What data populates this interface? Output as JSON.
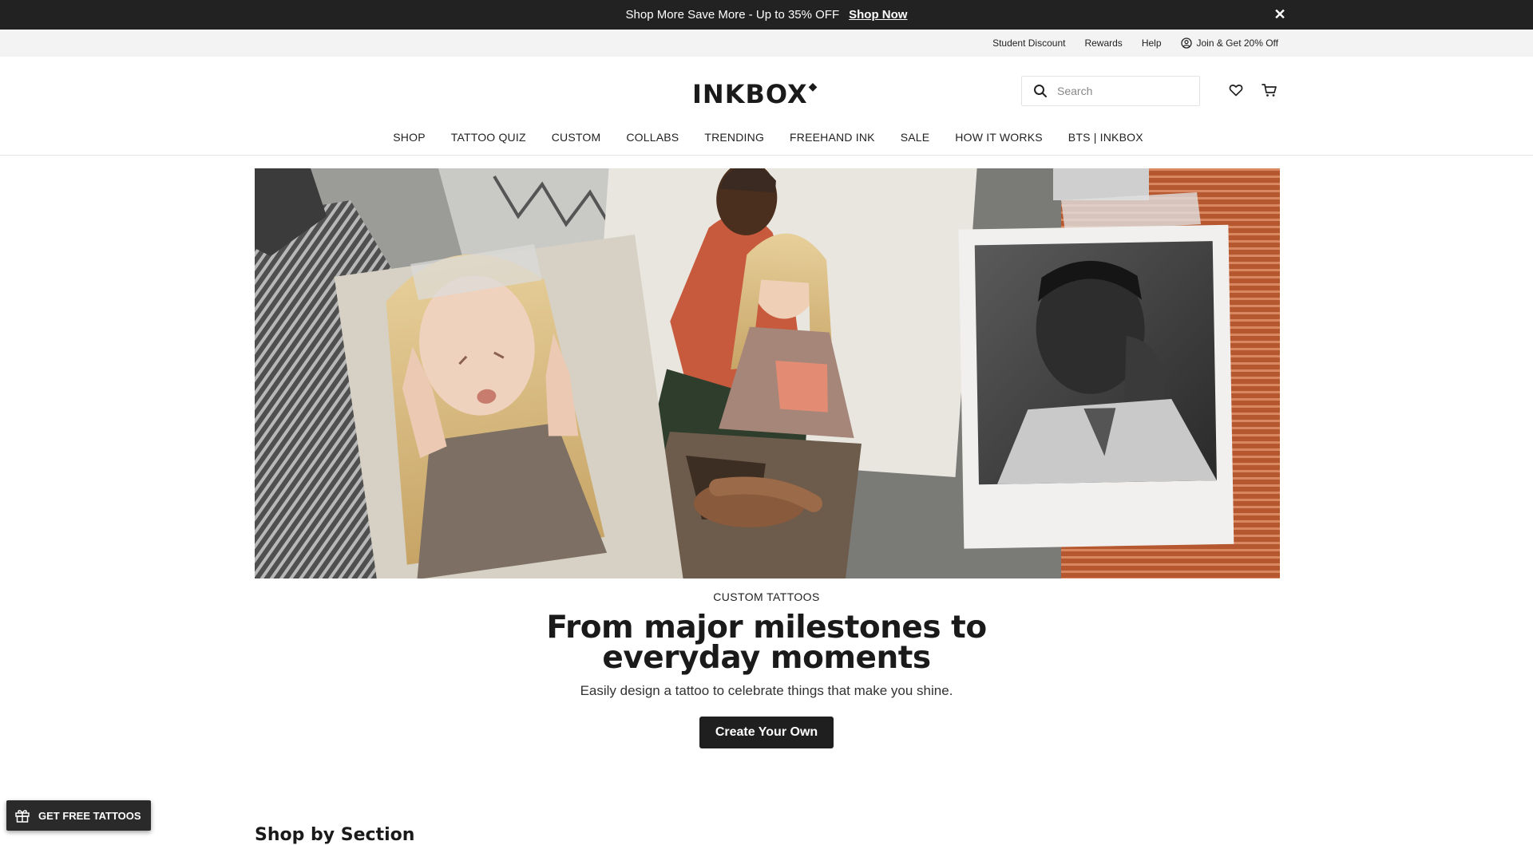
{
  "promo": {
    "text": "Shop More Save More - Up to 35% OFF",
    "link": "Shop Now",
    "close_icon": "close-icon"
  },
  "utility": {
    "student_discount": "Student Discount",
    "rewards": "Rewards",
    "help": "Help",
    "account": "Join & Get 20% Off",
    "account_icon": "user-circle-icon"
  },
  "header": {
    "logo": "INKBOX",
    "search_placeholder": "Search",
    "search_icon": "search-icon",
    "wishlist_icon": "heart-icon",
    "cart_icon": "cart-icon"
  },
  "nav": {
    "items": [
      "SHOP",
      "TATTOO QUIZ",
      "CUSTOM",
      "COLLABS",
      "TRENDING",
      "FREEHAND INK",
      "SALE",
      "HOW IT WORKS",
      "BTS | INKBOX"
    ]
  },
  "hero": {
    "eyebrow": "CUSTOM TATTOOS",
    "headline": "From major milestones to everyday moments",
    "subline": "Easily design a tattoo to celebrate things that make you shine.",
    "cta": "Create Your Own"
  },
  "section": {
    "heading": "Shop by Section"
  },
  "floating": {
    "free_tattoos": "GET FREE TATTOOS",
    "gift_icon": "gift-icon"
  },
  "colors": {
    "promo_bg": "#222222",
    "utility_bg": "#f3f3f3",
    "cta_bg": "#1f1f1f"
  }
}
